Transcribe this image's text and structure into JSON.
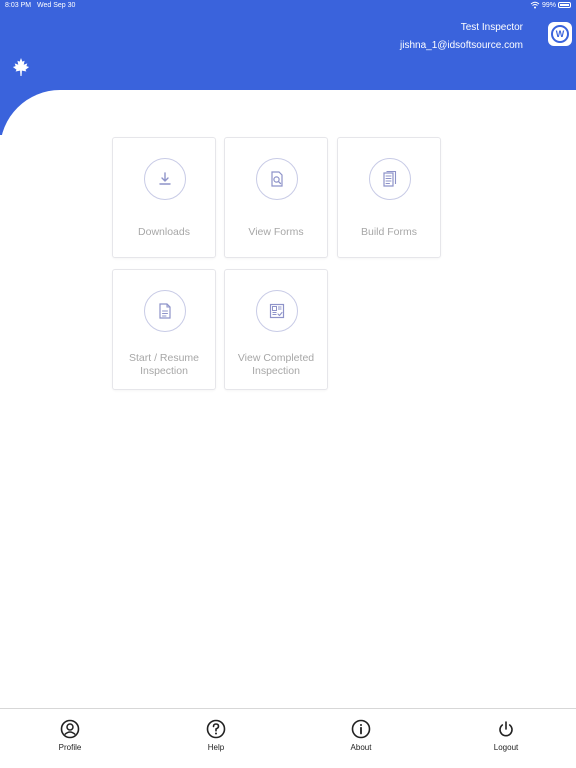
{
  "status_bar": {
    "time": "8:03 PM",
    "date": "Wed Sep 30",
    "battery": "99%"
  },
  "header": {
    "user_name": "Test Inspector",
    "user_email": "jishna_1@idsoftsource.com",
    "app_badge_letter": "W",
    "logo": "maple-leaf-icon"
  },
  "tiles": [
    {
      "label": "Downloads",
      "icon": "download-icon"
    },
    {
      "label": "View Forms",
      "icon": "view-forms-icon"
    },
    {
      "label": "Build Forms",
      "icon": "build-forms-icon"
    },
    {
      "label_line1": "Start / Resume",
      "label_line2": "Inspection",
      "icon": "document-icon"
    },
    {
      "label_line1": "View Completed",
      "label_line2": "Inspection",
      "icon": "completed-inspection-icon"
    }
  ],
  "tabbar": [
    {
      "label": "Profile",
      "icon": "profile-icon"
    },
    {
      "label": "Help",
      "icon": "help-icon"
    },
    {
      "label": "About",
      "icon": "info-icon"
    },
    {
      "label": "Logout",
      "icon": "power-icon"
    }
  ],
  "colors": {
    "header_blue": "#3a63dc",
    "tile_text": "#a7a7a7",
    "icon_tint": "#8e93c9"
  }
}
